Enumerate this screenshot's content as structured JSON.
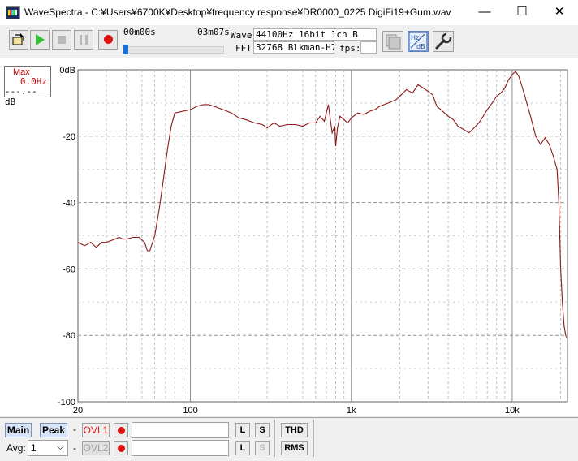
{
  "window": {
    "title": "WaveSpectra - C:¥Users¥6700K¥Desktop¥frequency response¥DR0000_0225 DigiFi19+Gum.wav",
    "minimize_glyph": "—",
    "maximize_glyph": "☐",
    "close_glyph": "✕"
  },
  "toolbar": {
    "time_start": "00m00s",
    "time_end": "03m07s",
    "wave_label": "Wave:",
    "wave_value": "44100Hz 16bit 1ch B",
    "fft_label": "FFT:",
    "fft_value": "32768 Blkman-H7",
    "fps_label": "fps:",
    "fps_value": "",
    "seek_fraction": 0.0,
    "icons": {
      "open": "folder-open-icon",
      "play": "play-icon",
      "stop": "stop-icon",
      "pause": "pause-icon",
      "record": "record-icon",
      "view": "view-mode-icon",
      "scale": "hz-db-scale-icon",
      "settings": "wrench-icon"
    }
  },
  "max_readout": {
    "label": "Max",
    "freq": "0.0Hz",
    "level": "---.--dB"
  },
  "chart_data": {
    "type": "line",
    "x_scale": "log",
    "xlim": [
      20,
      22050
    ],
    "ylim": [
      -100,
      0
    ],
    "y_ticks": [
      "0dB",
      "-20",
      "-40",
      "-60",
      "-80",
      "-100"
    ],
    "x_ticks": [
      "20",
      "100",
      "1k",
      "10k"
    ],
    "grid": true,
    "line_color": "#8b1a1a",
    "series": [
      {
        "x": [
          20,
          22,
          24,
          26,
          28,
          30,
          32,
          34,
          36,
          38,
          40,
          44,
          48,
          52,
          54,
          56,
          60,
          64,
          68,
          72,
          76,
          80,
          90,
          100,
          110,
          120,
          130,
          140,
          160,
          180,
          200,
          220,
          250,
          280,
          300,
          330,
          360,
          400,
          450,
          500,
          550,
          600,
          640,
          680,
          720,
          760,
          790,
          800,
          820,
          850,
          900,
          950,
          1000,
          1100,
          1200,
          1300,
          1400,
          1500,
          1700,
          1900,
          2000,
          2200,
          2400,
          2600,
          2800,
          3000,
          3200,
          3400,
          3600,
          3800,
          4000,
          4300,
          4600,
          5000,
          5400,
          5800,
          6200,
          6600,
          7000,
          7500,
          8000,
          8500,
          9000,
          9500,
          10000,
          10500,
          11000,
          11500,
          12000,
          13000,
          14000,
          15000,
          16000,
          17000,
          18000,
          19000,
          19500,
          20000,
          20500,
          21000,
          21500,
          22050
        ],
        "y": [
          -52,
          -53,
          -52,
          -53.5,
          -52,
          -52,
          -51.5,
          -51,
          -50.5,
          -51,
          -51,
          -50.5,
          -50.5,
          -52,
          -54.5,
          -54.5,
          -50,
          -42,
          -33,
          -24,
          -17,
          -13,
          -12.5,
          -12,
          -11,
          -10.5,
          -10.5,
          -11,
          -12,
          -13,
          -14.5,
          -15,
          -16,
          -16.5,
          -17.5,
          -16,
          -17,
          -16.5,
          -16.5,
          -17,
          -16,
          -16,
          -14,
          -15.5,
          -10.5,
          -19,
          -17,
          -23,
          -17.5,
          -14,
          -15,
          -16,
          -14.5,
          -13,
          -13.5,
          -12.5,
          -12,
          -11,
          -10,
          -9,
          -8,
          -6,
          -7,
          -4.5,
          -5.5,
          -6.5,
          -7.5,
          -11,
          -12,
          -13,
          -14,
          -15,
          -17,
          -18,
          -19,
          -17.5,
          -16,
          -14,
          -12,
          -10,
          -8,
          -7,
          -5.5,
          -3,
          -1.5,
          -0.5,
          -2,
          -5,
          -8,
          -14,
          -20,
          -22.5,
          -20.5,
          -22.5,
          -26,
          -30,
          -40,
          -60,
          -70,
          -77,
          -80,
          -81
        ]
      }
    ]
  },
  "bottom": {
    "main_label": "Main",
    "peak_label": "Peak",
    "dash1": "-",
    "dash2": "-",
    "ovl1_label": "OVL1",
    "ovl2_label": "OVL2",
    "l_label": "L",
    "s_label": "S",
    "l2_label": "L",
    "s2_label": "S",
    "thd_label": "THD",
    "rms_label": "RMS",
    "avg_label": "Avg:",
    "avg_value": "1",
    "dropdown_glyph": "⌵"
  }
}
